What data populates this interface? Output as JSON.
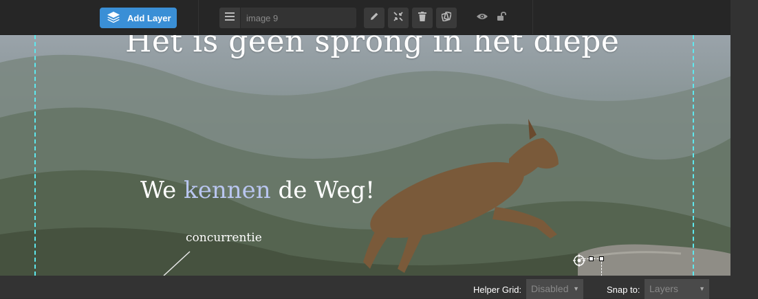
{
  "toolbar": {
    "add_layer_label": "Add Layer",
    "layer_name_value": "image 9"
  },
  "canvas": {
    "headline": "Het is geen sprong in het diepe",
    "tagline_before": "We ",
    "tagline_accent": "kennen",
    "tagline_after": " de Weg!",
    "callout": "concurrentie"
  },
  "bottom_bar": {
    "helper_grid_label": "Helper Grid:",
    "helper_grid_value": "Disabled",
    "snap_to_label": "Snap to:",
    "snap_to_value": "Layers"
  },
  "icons": [
    "layers-icon",
    "menu-icon",
    "pencil-icon",
    "shrink-icon",
    "trash-icon",
    "duplicate-icon",
    "eye-icon",
    "unlock-icon"
  ],
  "colors": {
    "accent": "#3a8fd6",
    "guide": "#5ee8ee",
    "toolbar": "#262626",
    "accent_text": "#b9c6f0"
  }
}
